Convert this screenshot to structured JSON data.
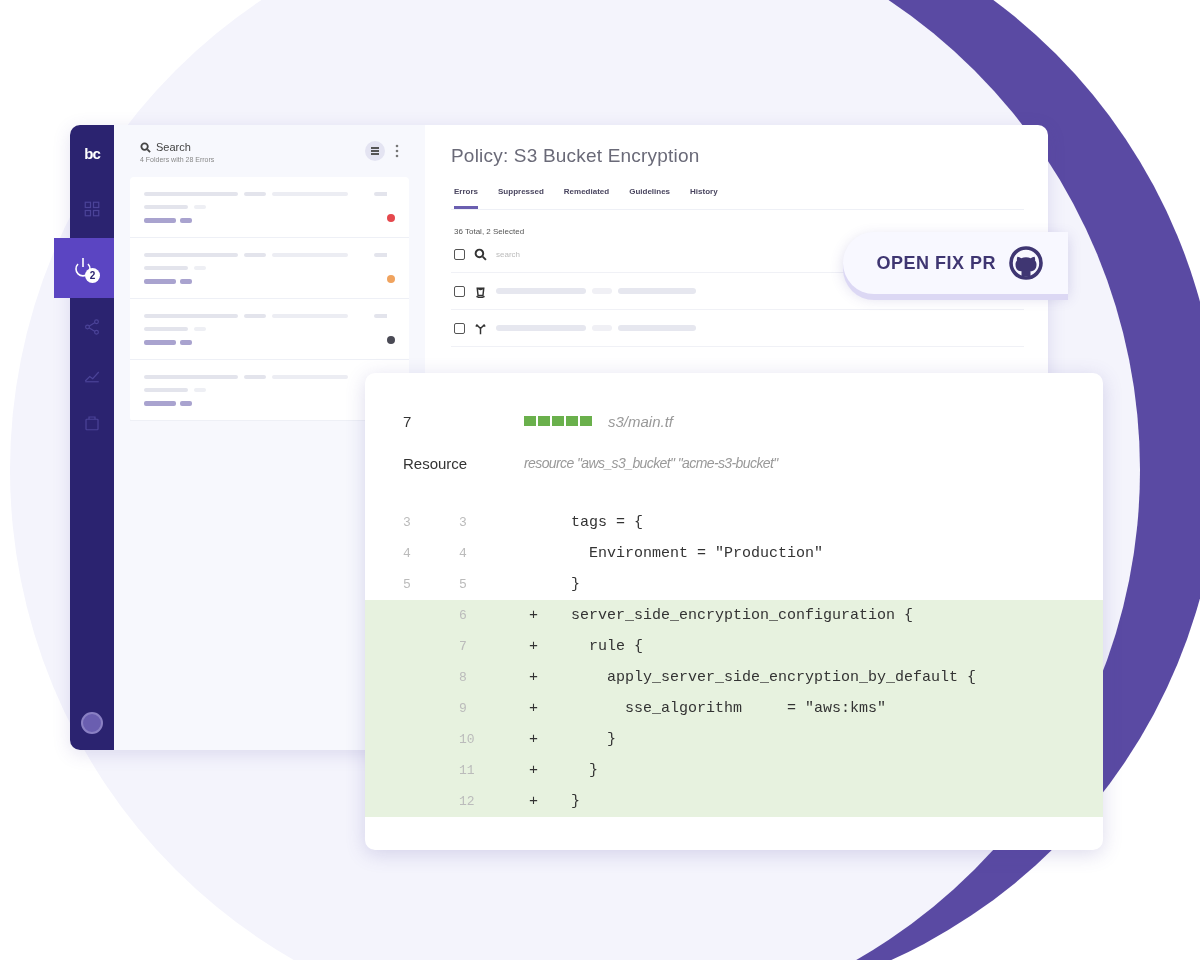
{
  "sidebar": {
    "logo": "bc",
    "items": [
      {
        "kind": "grid",
        "selected": false
      },
      {
        "kind": "fix",
        "selected": true,
        "badge": "2"
      },
      {
        "kind": "share",
        "selected": false
      },
      {
        "kind": "chart",
        "selected": false
      },
      {
        "kind": "bag",
        "selected": false
      }
    ]
  },
  "folders": {
    "search": "Search",
    "summary": "4 Folders with 28 Errors",
    "items": [
      {
        "kind": "flagged",
        "color": "#e5484d"
      },
      {
        "kind": "flagged",
        "color": "#f0a35e"
      },
      {
        "kind": "flagged",
        "color": "#4a4a55"
      },
      {
        "kind": "plain"
      }
    ]
  },
  "policy": {
    "title": "Policy: S3 Bucket Encryption",
    "tabs": [
      {
        "label": "Errors",
        "selected": true
      },
      {
        "label": "Suppressed",
        "selected": false
      },
      {
        "label": "Remediated",
        "selected": false
      },
      {
        "label": "Guidelines",
        "selected": false
      },
      {
        "label": "History",
        "selected": false
      }
    ],
    "summary": "36 Total, 2 Selected",
    "search_placeholder": "search",
    "search_checked": false,
    "resources": [
      {
        "kind": "aws",
        "checked": false
      },
      {
        "kind": "tree",
        "checked": false
      }
    ]
  },
  "fix_button": {
    "label": "OPEN FIX PR"
  },
  "diff": {
    "count": "7",
    "file": "s3/main.tf",
    "resource_label": "Resource",
    "resource": "resource \"aws_s3_bucket\" \"acme-s3-bucket\"",
    "lines": [
      {
        "kind": "context",
        "old": "3",
        "new": "3",
        "code": "tags = {"
      },
      {
        "kind": "context",
        "old": "4",
        "new": "4",
        "code": "  Environment = \"Production\""
      },
      {
        "kind": "context",
        "old": "5",
        "new": "5",
        "code": "}"
      },
      {
        "kind": "added",
        "new": "6",
        "marker": "+",
        "code": "server_side_encryption_configuration {"
      },
      {
        "kind": "added",
        "new": "7",
        "marker": "+",
        "code": "  rule {"
      },
      {
        "kind": "added",
        "new": "8",
        "marker": "+",
        "code": "    apply_server_side_encryption_by_default {"
      },
      {
        "kind": "added",
        "new": "9",
        "marker": "+",
        "code": "      sse_algorithm     = \"aws:kms\""
      },
      {
        "kind": "added",
        "new": "10",
        "marker": "+",
        "code": "    }"
      },
      {
        "kind": "added",
        "new": "11",
        "marker": "+",
        "code": "  }"
      },
      {
        "kind": "added",
        "new": "12",
        "marker": "+",
        "code": "}"
      }
    ]
  }
}
